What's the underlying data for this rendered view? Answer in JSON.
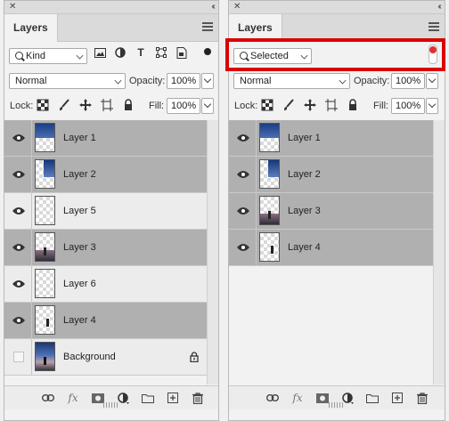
{
  "panels": {
    "left": {
      "tab_title": "Layers",
      "filter": {
        "selected": "Kind"
      },
      "blend_mode": "Normal",
      "opacity_label": "Opacity:",
      "opacity_value": "100%",
      "lock_label": "Lock:",
      "fill_label": "Fill:",
      "fill_value": "100%",
      "layers": [
        {
          "name": "Layer 1",
          "selected": true,
          "visible": true
        },
        {
          "name": "Layer 2",
          "selected": true,
          "visible": true
        },
        {
          "name": "Layer 5",
          "selected": false,
          "visible": true
        },
        {
          "name": "Layer 3",
          "selected": true,
          "visible": true
        },
        {
          "name": "Layer 6",
          "selected": false,
          "visible": true
        },
        {
          "name": "Layer 4",
          "selected": true,
          "visible": true
        },
        {
          "name": "Background",
          "selected": false,
          "visible": false,
          "locked": true
        }
      ]
    },
    "right": {
      "tab_title": "Layers",
      "filter": {
        "selected": "Selected"
      },
      "blend_mode": "Normal",
      "opacity_label": "Opacity:",
      "opacity_value": "100%",
      "lock_label": "Lock:",
      "fill_label": "Fill:",
      "fill_value": "100%",
      "layers": [
        {
          "name": "Layer 1",
          "selected": true,
          "visible": true
        },
        {
          "name": "Layer 2",
          "selected": true,
          "visible": true
        },
        {
          "name": "Layer 3",
          "selected": true,
          "visible": true
        },
        {
          "name": "Layer 4",
          "selected": true,
          "visible": true
        }
      ]
    }
  },
  "colors": {
    "highlight": "#d90000",
    "filter_toggle_on": "#e03030",
    "selected_row": "#b0b0b0"
  }
}
